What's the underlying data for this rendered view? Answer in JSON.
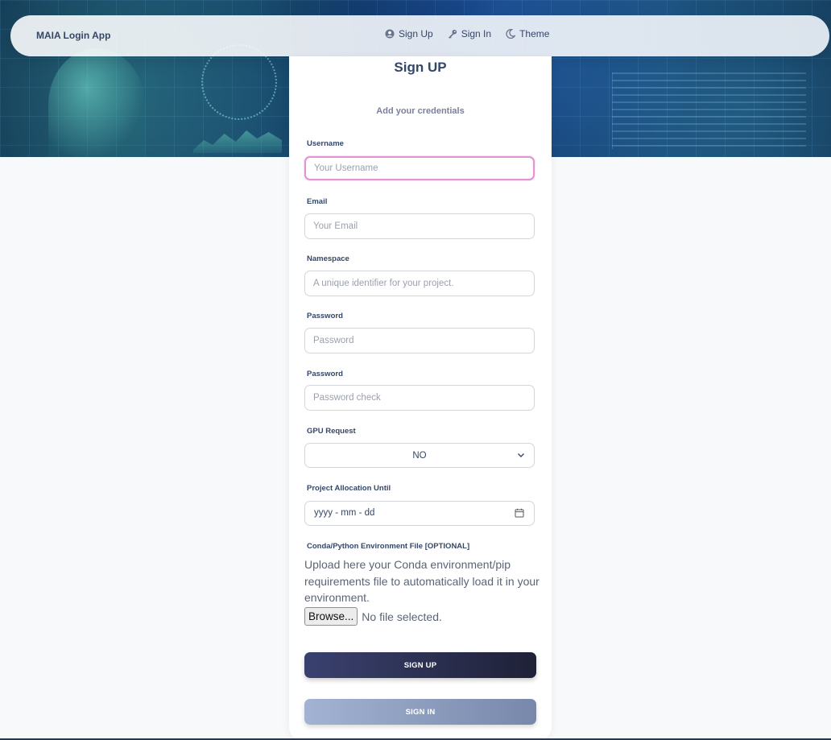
{
  "navbar": {
    "brand": "MAIA Login App",
    "links": [
      {
        "label": "Sign Up",
        "icon": "user-circle-icon"
      },
      {
        "label": "Sign In",
        "icon": "key-icon"
      },
      {
        "label": "Theme",
        "icon": "moon-icon"
      }
    ]
  },
  "form": {
    "title": "Sign UP",
    "subtitle": "Add your credentials",
    "username": {
      "label": "Username",
      "placeholder": "Your Username"
    },
    "email": {
      "label": "Email",
      "placeholder": "Your Email"
    },
    "namespace": {
      "label": "Namespace",
      "placeholder": "A unique identifier for your project."
    },
    "password": {
      "label": "Password",
      "placeholder": "Password"
    },
    "password_check": {
      "label": "Password",
      "placeholder": "Password check"
    },
    "gpu": {
      "label": "GPU Request",
      "value": "NO"
    },
    "allocation": {
      "label": "Project Allocation Until",
      "value": "yyyy - mm - dd"
    },
    "env_file": {
      "label": "Conda/Python Environment File [OPTIONAL]",
      "help": "Upload here your Conda environment/pip requirements file to automatically load it in your environment.",
      "browse_label": "Browse...",
      "status": "No file selected."
    },
    "signup_label": "SIGN UP",
    "signin_label": "SIGN IN"
  },
  "colors": {
    "primary_dark": "#1f2137",
    "secondary": "#7788aa",
    "focus": "#e293d3"
  }
}
